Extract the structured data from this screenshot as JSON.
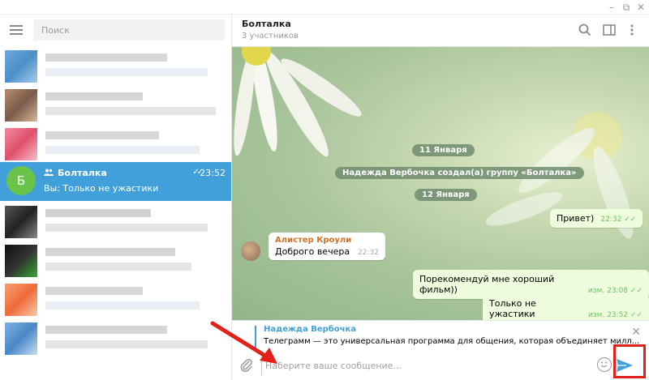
{
  "window": {
    "minimize": "–",
    "restore": "⧉",
    "close": "✕"
  },
  "sidebar": {
    "search_placeholder": "Поиск",
    "active_chat": {
      "avatar_letter": "Б",
      "title": "Болталка",
      "time": "23:52",
      "preview": "Вы: Только не ужастики"
    }
  },
  "header": {
    "title": "Болталка",
    "subtitle": "3 участников"
  },
  "messages": {
    "date1": "11 Января",
    "service1": "Надежда Вербочка создал(а) группу «Болталка»",
    "date2": "12 Января",
    "out1": {
      "text": "Привет)",
      "time": "22:32"
    },
    "in1": {
      "sender": "Алистер Кроули",
      "text": "Доброго вечера",
      "time": "22:32"
    },
    "out2": {
      "text": "Порекомендуй мне хороший фильм))",
      "time": "изм. 23:08"
    },
    "out3": {
      "text": "Только не ужастики",
      "time": "изм. 23:52"
    }
  },
  "reply": {
    "name": "Надежда Вербочка",
    "text": "Телеграмм — это универсальная программа для общения, которая объединяет милл..."
  },
  "input": {
    "placeholder": "Наберите ваше сообщение..."
  },
  "colors": {
    "accent": "#419fd9",
    "highlight": "#e2211c",
    "bubble_out": "#effdde"
  }
}
